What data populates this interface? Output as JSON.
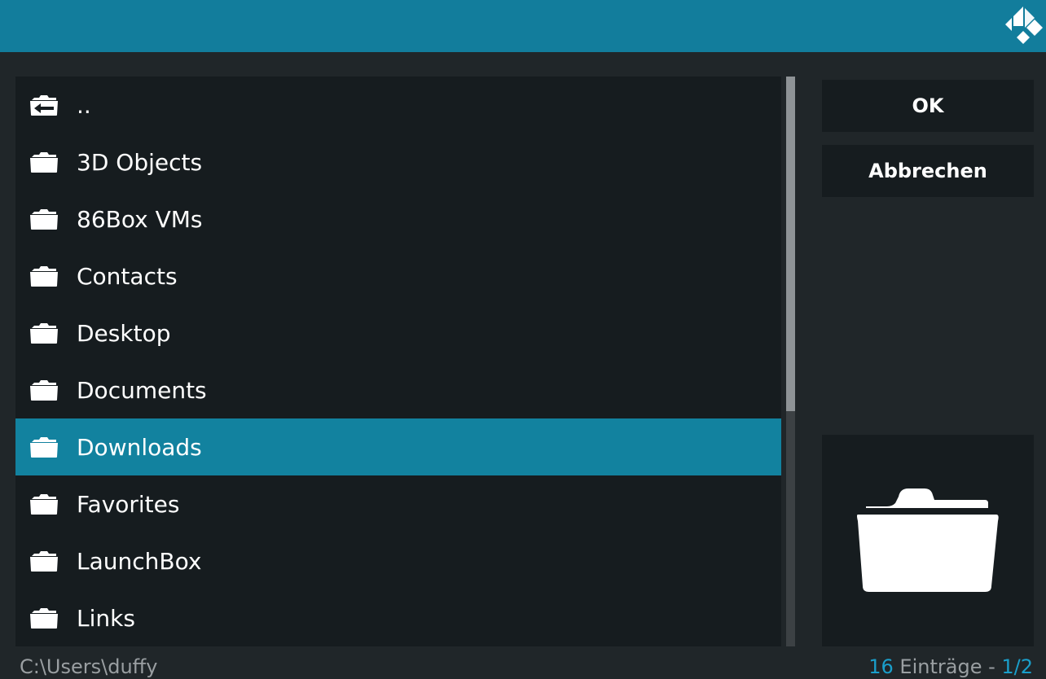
{
  "header": {
    "logo_icon": "kodi-logo-icon"
  },
  "file_list": {
    "items": [
      {
        "label": "..",
        "icon": "folder-back-icon"
      },
      {
        "label": "3D Objects",
        "icon": "folder-icon"
      },
      {
        "label": "86Box VMs",
        "icon": "folder-icon"
      },
      {
        "label": "Contacts",
        "icon": "folder-icon"
      },
      {
        "label": "Desktop",
        "icon": "folder-icon"
      },
      {
        "label": "Documents",
        "icon": "folder-icon"
      },
      {
        "label": "Downloads",
        "icon": "folder-icon",
        "selected": true
      },
      {
        "label": "Favorites",
        "icon": "folder-icon"
      },
      {
        "label": "LaunchBox",
        "icon": "folder-icon"
      },
      {
        "label": "Links",
        "icon": "folder-icon"
      }
    ]
  },
  "buttons": {
    "ok_label": "OK",
    "cancel_label": "Abbrechen"
  },
  "preview": {
    "icon": "folder-large-icon"
  },
  "footer": {
    "path": "C:\\Users\\duffy",
    "count": "16",
    "count_suffix": " Einträge - ",
    "page": "1/2"
  },
  "colors": {
    "accent": "#127d9c",
    "selected_row": "#12829f",
    "status_accent": "#1a9fcb"
  }
}
